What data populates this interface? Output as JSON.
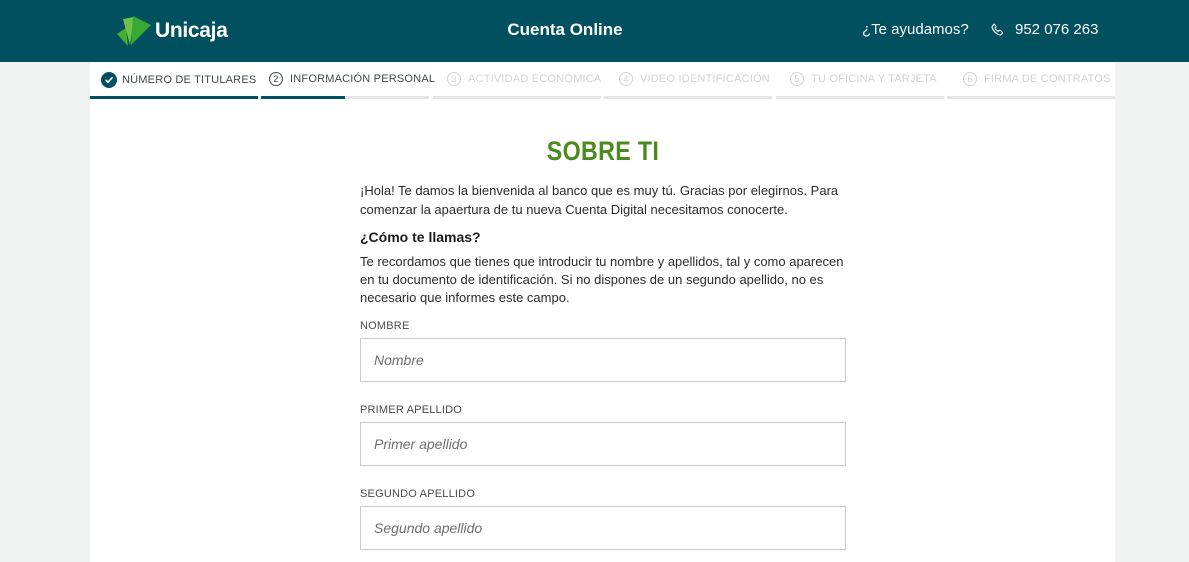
{
  "header": {
    "brand": "Unicaja",
    "title": "Cuenta Online",
    "help": "¿Te ayudamos?",
    "phone": "952 076 263",
    "colors": {
      "bar": "#00505f",
      "logo_green": "#45b02a"
    }
  },
  "steps": [
    {
      "number": "1",
      "label": "NÚMERO DE TITULARES",
      "status": "done",
      "progress": 1
    },
    {
      "number": "2",
      "label": "INFORMACIÓN PERSONAL",
      "status": "active",
      "progress": 0.5
    },
    {
      "number": "3",
      "label": "ACTIVIDAD ECONÓMICA",
      "status": "pending",
      "progress": 0
    },
    {
      "number": "4",
      "label": "VIDEO IDENTIFICACIÓN",
      "status": "pending",
      "progress": 0
    },
    {
      "number": "5",
      "label": "TU OFICINA Y TARJETA",
      "status": "pending",
      "progress": 0
    },
    {
      "number": "6",
      "label": "FIRMA DE CONTRATOS",
      "status": "pending",
      "progress": 0
    }
  ],
  "form": {
    "title": "SOBRE TI",
    "intro": "¡Hola! Te damos la bienvenida al banco que es muy tú. Gracias por elegirnos. Para comenzar la apaertura de tu nueva Cuenta Digital necesitamos conocerte.",
    "question": "¿Cómo te llamas?",
    "hint": "Te recordamos que tienes que introducir tu nombre y apellidos, tal y como aparecen en tu documento de identificación. Si no dispones de un segundo apellido, no es necesario que informes este campo.",
    "fields": [
      {
        "label": "NOMBRE",
        "placeholder": "Nombre",
        "value": ""
      },
      {
        "label": "PRIMER APELLIDO",
        "placeholder": "Primer apellido",
        "value": ""
      },
      {
        "label": "SEGUNDO APELLIDO",
        "placeholder": "Segundo apellido",
        "value": ""
      }
    ],
    "title_color": "#4b8a1e"
  }
}
